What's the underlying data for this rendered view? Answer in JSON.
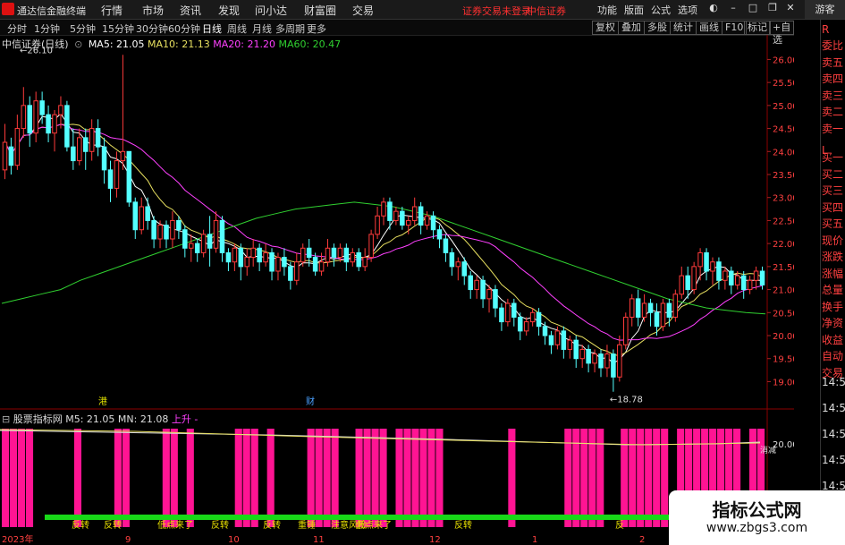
{
  "titlebar": {
    "app_title": "通达信金融终端",
    "menus": [
      "行情",
      "市场",
      "资讯",
      "发现",
      "问小达",
      "财富圈",
      "交易"
    ],
    "warning": "证券交易未登录",
    "broker": "中信证券",
    "right_menus": [
      "功能",
      "版面",
      "公式",
      "选项"
    ],
    "guest": "游客"
  },
  "periods": [
    "分时",
    "1分钟",
    "5分钟",
    "15分钟",
    "30分钟",
    "60分钟",
    "日线",
    "周线",
    "月线",
    "多周期",
    "更多"
  ],
  "active_period": "日线",
  "tools": [
    "复权",
    "叠加",
    "多股",
    "统计",
    "画线",
    "F10",
    "标记",
    "+自选"
  ],
  "stock": {
    "name": "中信证券(日线)",
    "ma5": "MA5: 21.05",
    "ma10": "MA10: 21.13",
    "ma20": "MA20: 21.20",
    "ma60": "MA60: 20.47"
  },
  "price_axis": [
    "26.00",
    "25.50",
    "25.00",
    "24.50",
    "24.00",
    "23.50",
    "23.00",
    "22.50",
    "22.00",
    "21.50",
    "21.00",
    "20.50",
    "20.00",
    "19.50",
    "19.00"
  ],
  "high_label": "26.10",
  "low_label": "18.78",
  "markers": [
    "港",
    "财"
  ],
  "side_panel": [
    "委比",
    "卖五",
    "卖四",
    "卖三",
    "卖二",
    "卖一",
    "买一",
    "买二",
    "买三",
    "买四",
    "买五",
    "现价",
    "涨跌",
    "涨幅",
    "总量",
    "换手",
    "净资",
    "收益",
    "自动",
    "交易"
  ],
  "side_letters": [
    "R",
    "L"
  ],
  "side_times": [
    "14:50",
    "14:50",
    "14:50",
    "14:50",
    "14:50",
    "14:50"
  ],
  "indicator": {
    "name": "股票指标网",
    "m5": "M5: 21.05",
    "mn": "MN: 21.08",
    "trend": "上升",
    "dash": "-",
    "axis_label": "20.00",
    "signals": [
      "反转",
      "反转",
      "低点来了",
      "反转",
      "反转",
      "重锤",
      "注意风险",
      "低点来了",
      "反转",
      "反"
    ],
    "right_tag": "消减"
  },
  "date_axis": [
    "2023年",
    "9",
    "10",
    "11",
    "12",
    "1",
    "2"
  ],
  "watermark": {
    "line1": "指标公式网",
    "line2": "www.zbgs3.com"
  },
  "colors": {
    "up": "#ff3b3b",
    "down": "#54ffff",
    "ma5": "#ffffff",
    "ma10": "#e8e060",
    "ma20": "#ff40ff",
    "ma60": "#30d030",
    "indicator_bar": "#ff1493",
    "signal_green": "#18d818"
  },
  "chart_data": {
    "type": "candlestick",
    "ylim": [
      18.6,
      26.3
    ],
    "candles": [
      [
        23.6,
        24.2,
        24.6,
        23.4
      ],
      [
        24.1,
        23.7,
        24.3,
        23.5
      ],
      [
        23.7,
        24.5,
        24.8,
        23.6
      ],
      [
        24.5,
        25.0,
        25.4,
        24.3
      ],
      [
        25.0,
        24.4,
        25.2,
        24.1
      ],
      [
        24.4,
        25.1,
        25.3,
        24.2
      ],
      [
        25.1,
        24.8,
        25.3,
        24.6
      ],
      [
        24.8,
        24.4,
        25.0,
        24.2
      ],
      [
        24.4,
        24.8,
        24.9,
        24.0
      ],
      [
        24.8,
        25.0,
        25.2,
        24.5
      ],
      [
        25.0,
        24.1,
        25.1,
        24.0
      ],
      [
        24.1,
        23.8,
        24.5,
        23.6
      ],
      [
        23.8,
        24.3,
        24.5,
        23.7
      ],
      [
        24.3,
        24.0,
        24.5,
        23.6
      ],
      [
        24.0,
        24.5,
        24.7,
        23.8
      ],
      [
        24.5,
        24.1,
        24.7,
        23.9
      ],
      [
        24.1,
        23.6,
        24.3,
        23.3
      ],
      [
        23.6,
        23.2,
        23.8,
        22.9
      ],
      [
        23.2,
        23.8,
        24.0,
        23.0
      ],
      [
        23.8,
        24.0,
        26.1,
        23.6
      ],
      [
        24.0,
        22.9,
        24.0,
        22.8
      ],
      [
        22.9,
        22.3,
        23.0,
        22.1
      ],
      [
        22.3,
        22.8,
        23.0,
        22.2
      ],
      [
        22.8,
        22.5,
        23.0,
        22.3
      ],
      [
        22.5,
        22.1,
        22.6,
        21.9
      ],
      [
        22.1,
        22.4,
        22.5,
        21.9
      ],
      [
        22.4,
        22.1,
        22.5,
        21.9
      ],
      [
        22.1,
        22.5,
        22.7,
        21.9
      ],
      [
        22.5,
        22.3,
        22.6,
        22.1
      ],
      [
        22.3,
        21.9,
        22.4,
        21.7
      ],
      [
        21.9,
        22.0,
        22.2,
        21.6
      ],
      [
        22.0,
        21.8,
        22.1,
        21.6
      ],
      [
        21.8,
        22.2,
        22.3,
        21.7
      ],
      [
        22.2,
        21.9,
        22.6,
        21.5
      ],
      [
        21.9,
        22.5,
        22.7,
        21.8
      ],
      [
        22.5,
        21.8,
        22.6,
        21.6
      ],
      [
        21.8,
        21.6,
        21.9,
        21.4
      ],
      [
        21.6,
        21.9,
        22.0,
        21.4
      ],
      [
        21.9,
        21.5,
        22.0,
        21.2
      ],
      [
        21.5,
        21.7,
        21.9,
        21.3
      ],
      [
        21.7,
        21.9,
        22.1,
        21.5
      ],
      [
        21.9,
        21.6,
        22.0,
        21.4
      ],
      [
        21.6,
        21.8,
        22.0,
        21.5
      ],
      [
        21.8,
        21.4,
        21.9,
        21.2
      ],
      [
        21.4,
        21.7,
        21.8,
        21.2
      ],
      [
        21.7,
        21.5,
        21.9,
        21.3
      ],
      [
        21.5,
        21.2,
        21.6,
        21.0
      ],
      [
        21.2,
        21.6,
        21.8,
        21.1
      ],
      [
        21.6,
        21.9,
        22.0,
        21.5
      ],
      [
        21.9,
        21.7,
        22.1,
        21.5
      ],
      [
        21.7,
        21.4,
        21.8,
        21.3
      ],
      [
        21.4,
        21.6,
        21.8,
        21.3
      ],
      [
        21.6,
        21.9,
        22.1,
        21.5
      ],
      [
        21.9,
        21.7,
        22.0,
        21.5
      ],
      [
        21.7,
        21.9,
        22.0,
        21.6
      ],
      [
        21.9,
        21.6,
        22.0,
        21.4
      ],
      [
        21.6,
        21.8,
        21.9,
        21.5
      ],
      [
        21.8,
        21.5,
        21.9,
        21.4
      ],
      [
        21.5,
        21.7,
        21.9,
        21.4
      ],
      [
        21.7,
        22.2,
        22.3,
        21.6
      ],
      [
        22.2,
        22.6,
        22.8,
        22.1
      ],
      [
        22.6,
        22.9,
        23.0,
        22.4
      ],
      [
        22.9,
        22.5,
        23.0,
        22.3
      ],
      [
        22.5,
        22.7,
        22.8,
        22.4
      ],
      [
        22.7,
        22.4,
        22.8,
        22.3
      ],
      [
        22.4,
        22.5,
        22.6,
        22.2
      ],
      [
        22.5,
        22.8,
        23.0,
        22.4
      ],
      [
        22.8,
        22.4,
        22.9,
        22.2
      ],
      [
        22.4,
        22.6,
        22.7,
        22.3
      ],
      [
        22.6,
        22.3,
        22.7,
        22.1
      ],
      [
        22.3,
        22.1,
        22.4,
        21.9
      ],
      [
        22.1,
        21.8,
        22.2,
        21.6
      ],
      [
        21.8,
        21.5,
        21.9,
        21.3
      ],
      [
        21.5,
        21.6,
        21.7,
        21.2
      ],
      [
        21.6,
        21.3,
        21.7,
        21.1
      ],
      [
        21.3,
        21.0,
        21.4,
        20.8
      ],
      [
        21.0,
        21.2,
        21.3,
        20.8
      ],
      [
        21.2,
        20.8,
        21.3,
        20.6
      ],
      [
        20.8,
        21.0,
        21.1,
        20.5
      ],
      [
        21.0,
        20.6,
        21.1,
        20.4
      ],
      [
        20.6,
        20.3,
        20.7,
        20.1
      ],
      [
        20.3,
        20.7,
        20.8,
        20.2
      ],
      [
        20.7,
        20.4,
        20.8,
        20.2
      ],
      [
        20.4,
        20.1,
        20.5,
        19.9
      ],
      [
        20.1,
        20.3,
        20.4,
        20.0
      ],
      [
        20.3,
        20.5,
        20.6,
        20.2
      ],
      [
        20.5,
        20.2,
        20.6,
        20.0
      ],
      [
        20.2,
        20.0,
        20.3,
        19.8
      ],
      [
        20.0,
        19.8,
        20.1,
        19.6
      ],
      [
        19.8,
        20.1,
        20.2,
        19.7
      ],
      [
        20.1,
        19.7,
        20.2,
        19.5
      ],
      [
        19.7,
        19.9,
        20.0,
        19.5
      ],
      [
        19.9,
        19.5,
        20.0,
        19.3
      ],
      [
        19.5,
        19.7,
        19.8,
        19.3
      ],
      [
        19.7,
        19.4,
        19.8,
        19.2
      ],
      [
        19.4,
        19.6,
        19.7,
        19.2
      ],
      [
        19.6,
        19.3,
        19.7,
        19.1
      ],
      [
        19.3,
        19.6,
        19.8,
        19.1
      ],
      [
        19.6,
        19.1,
        19.7,
        18.78
      ],
      [
        19.1,
        19.8,
        20.0,
        19.0
      ],
      [
        19.8,
        20.4,
        20.5,
        19.7
      ],
      [
        20.4,
        20.8,
        20.9,
        20.2
      ],
      [
        20.8,
        20.4,
        21.0,
        20.2
      ],
      [
        20.4,
        20.7,
        20.9,
        20.3
      ],
      [
        20.7,
        20.5,
        20.8,
        20.2
      ],
      [
        20.5,
        20.2,
        20.7,
        20.0
      ],
      [
        20.2,
        20.7,
        20.8,
        20.1
      ],
      [
        20.7,
        20.4,
        20.8,
        20.2
      ],
      [
        20.4,
        20.9,
        21.0,
        20.3
      ],
      [
        20.9,
        21.3,
        21.5,
        20.8
      ],
      [
        21.3,
        21.0,
        21.5,
        20.8
      ],
      [
        21.0,
        21.5,
        21.6,
        20.9
      ],
      [
        21.5,
        21.8,
        21.9,
        21.2
      ],
      [
        21.8,
        21.4,
        21.9,
        21.2
      ],
      [
        21.4,
        21.6,
        21.7,
        21.1
      ],
      [
        21.6,
        21.2,
        21.7,
        21.0
      ],
      [
        21.2,
        21.4,
        21.5,
        21.0
      ],
      [
        21.4,
        21.1,
        21.5,
        20.9
      ],
      [
        21.1,
        21.3,
        21.4,
        21.0
      ],
      [
        21.3,
        21.0,
        21.4,
        20.8
      ],
      [
        21.0,
        21.2,
        21.3,
        20.9
      ],
      [
        21.2,
        21.4,
        21.5,
        21.0
      ],
      [
        21.4,
        21.1,
        21.5,
        21.0
      ]
    ],
    "ma60": [
      20.7,
      20.8,
      20.9,
      21.0,
      21.2,
      21.35,
      21.5,
      21.65,
      21.8,
      21.95,
      22.1,
      22.25,
      22.4,
      22.55,
      22.65,
      22.75,
      22.8,
      22.85,
      22.9,
      22.85,
      22.8,
      22.7,
      22.6,
      22.45,
      22.3,
      22.15,
      22.0,
      21.85,
      21.7,
      21.55,
      21.4,
      21.25,
      21.1,
      20.95,
      20.8,
      20.7,
      20.6,
      20.55,
      20.5,
      20.47
    ],
    "indicator_bars": [
      1,
      1,
      1,
      1,
      0,
      0,
      0,
      0,
      0,
      1,
      0,
      0,
      0,
      0,
      1,
      1,
      0,
      0,
      0,
      0,
      1,
      1,
      0,
      1,
      0,
      0,
      0,
      0,
      0,
      1,
      1,
      1,
      0,
      1,
      0,
      0,
      0,
      0,
      1,
      1,
      1,
      1,
      0,
      0,
      1,
      1,
      1,
      1,
      0,
      1,
      1,
      1,
      1,
      1,
      1,
      0,
      0,
      0,
      0,
      0,
      0,
      0,
      0,
      1,
      0,
      0,
      0,
      0,
      0,
      0,
      1,
      1,
      1,
      1,
      1,
      0,
      0,
      1,
      1,
      1,
      1,
      1,
      1,
      0,
      1,
      1,
      1,
      1,
      1,
      1,
      1,
      1,
      0,
      1,
      1
    ]
  }
}
